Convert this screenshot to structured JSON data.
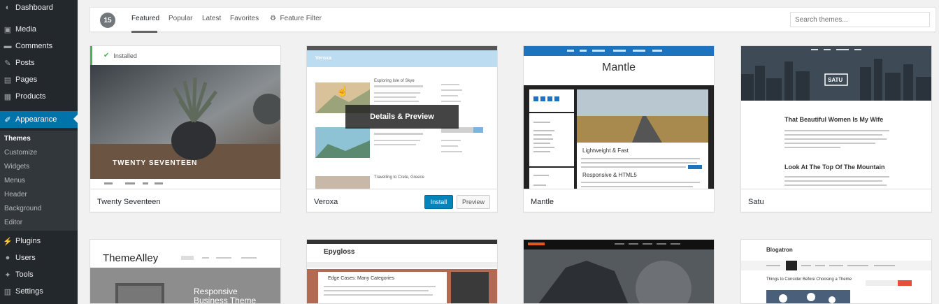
{
  "sidebar": {
    "items": [
      {
        "label": "Dashboard",
        "icon": "dashboard-icon",
        "glyph": "◐"
      },
      {
        "label": "Media",
        "icon": "media-icon",
        "glyph": "▣"
      },
      {
        "label": "Comments",
        "icon": "comments-icon",
        "glyph": "▬"
      },
      {
        "label": "Posts",
        "icon": "posts-icon",
        "glyph": "✎"
      },
      {
        "label": "Pages",
        "icon": "pages-icon",
        "glyph": "▤"
      },
      {
        "label": "Products",
        "icon": "products-icon",
        "glyph": "▦"
      },
      {
        "label": "Appearance",
        "icon": "appearance-icon",
        "glyph": "✐"
      }
    ],
    "submenu": [
      "Themes",
      "Customize",
      "Widgets",
      "Menus",
      "Header",
      "Background",
      "Editor"
    ],
    "bottom_items": [
      {
        "label": "Plugins",
        "icon": "plugins-icon",
        "glyph": "⚡"
      },
      {
        "label": "Users",
        "icon": "users-icon",
        "glyph": "●"
      },
      {
        "label": "Tools",
        "icon": "tools-icon",
        "glyph": "✦"
      },
      {
        "label": "Settings",
        "icon": "settings-icon",
        "glyph": "▥"
      }
    ]
  },
  "filter": {
    "count": "15",
    "tabs": [
      "Featured",
      "Popular",
      "Latest",
      "Favorites"
    ],
    "feature_filter": "Feature Filter",
    "search_placeholder": "Search themes..."
  },
  "themes": {
    "twenty_seventeen": {
      "name": "Twenty Seventeen",
      "installed": "Installed",
      "hero": "TWENTY SEVENTEEN"
    },
    "veroxa": {
      "name": "Veroxa",
      "overlay": "Details & Preview",
      "install": "Install",
      "preview": "Preview",
      "brand": "Veroxa",
      "post1": "Exploring Isle of Skye",
      "post2": "Travelling to Crete, Greece"
    },
    "mantle": {
      "name": "Mantle",
      "title": "Mantle",
      "h1": "Lightweight & Fast",
      "h2": "Responsive & HTML5"
    },
    "satu": {
      "name": "Satu",
      "logo": "SATU",
      "h1": "That Beautiful Women Is My Wife",
      "h2": "Look At The Top Of The Mountain"
    },
    "themealley": {
      "brand": "ThemeAlley",
      "tagline": "Responsive Business Theme"
    },
    "epygloss": {
      "brand": "Epygloss",
      "heading": "Edge Cases: Many Categories"
    },
    "blogatron": {
      "brand": "Blogatron",
      "heading": "Things to Consider Before Choosing a Theme"
    }
  },
  "colors": {
    "sidebar": "#23282d",
    "accent": "#0073aa",
    "installed": "#46b450",
    "install_button": "#0085ba"
  }
}
